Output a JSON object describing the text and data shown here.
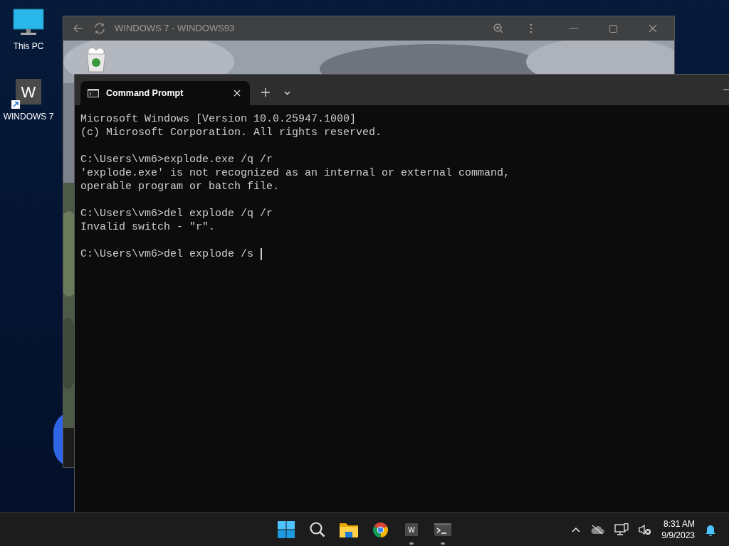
{
  "desktop_icons": [
    {
      "kind": "monitor",
      "label": "This PC"
    },
    {
      "kind": "shortcut",
      "glyph": "W",
      "label": "WINDOWS 7"
    }
  ],
  "back_window": {
    "title": "WINDOWS 7 - WINDOWS93"
  },
  "terminal": {
    "tabs": [
      {
        "label": "Command Prompt",
        "selected": true
      }
    ],
    "blocks": [
      [
        "Microsoft Windows [Version 10.0.25947.1000]",
        "(c) Microsoft Corporation. All rights reserved."
      ],
      [
        "C:\\Users\\vm6>explode.exe /q /r",
        "'explode.exe' is not recognized as an internal or external command,",
        "operable program or batch file."
      ],
      [
        "C:\\Users\\vm6>del explode /q /r",
        "Invalid switch - \"r\"."
      ],
      [
        "C:\\Users\\vm6>del explode /s"
      ]
    ]
  },
  "taskbar": {
    "apps": [
      {
        "kind": "start",
        "running": false
      },
      {
        "kind": "search",
        "running": false
      },
      {
        "kind": "folder",
        "running": false
      },
      {
        "kind": "browser",
        "running": false
      },
      {
        "kind": "app",
        "glyph": "W",
        "running": true
      },
      {
        "kind": "terminal",
        "running": true
      }
    ],
    "time": "8:31 AM",
    "date": "9/9/2023"
  }
}
